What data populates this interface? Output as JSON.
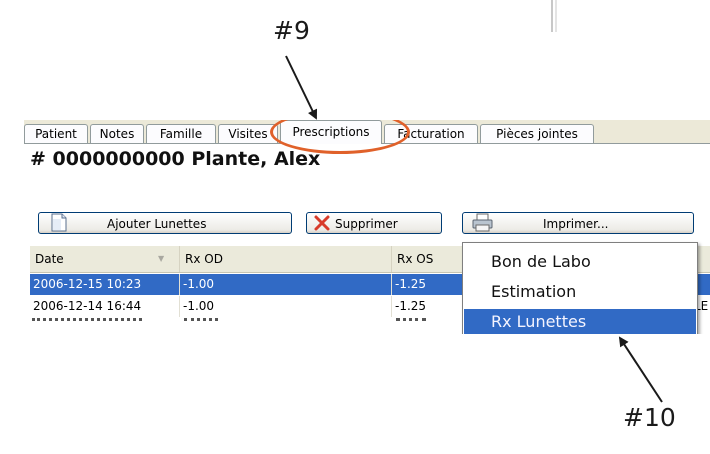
{
  "callouts": {
    "top": "#9",
    "bottom": "#10"
  },
  "tabs": [
    {
      "label": "Patient"
    },
    {
      "label": "Notes"
    },
    {
      "label": "Famille"
    },
    {
      "label": "Visites"
    },
    {
      "label": "Prescriptions"
    },
    {
      "label": "Facturation"
    },
    {
      "label": "Pièces jointes"
    }
  ],
  "panel": {
    "title": "# 0000000000  Plante, Alex"
  },
  "toolbar": {
    "add_label": "Ajouter Lunettes",
    "delete_label": "Supprimer",
    "print_label": "Imprimer..."
  },
  "grid": {
    "columns": [
      "Date",
      "Rx OD",
      "Rx OS"
    ],
    "rows": [
      {
        "date": "2006-12-15 10:23",
        "od": "-1.00",
        "os": "-1.25",
        "selected": true
      },
      {
        "date": "2006-12-14 16:44",
        "od": "-1.00",
        "os": "-1.25",
        "selected": false,
        "tail": "LE"
      }
    ]
  },
  "print_menu": {
    "items": [
      {
        "label": "Bon de Labo"
      },
      {
        "label": "Estimation"
      },
      {
        "label": "Rx Lunettes",
        "selected": true
      }
    ]
  },
  "colors": {
    "selection": "#316ac5",
    "highlight_ring": "#e0612a"
  }
}
